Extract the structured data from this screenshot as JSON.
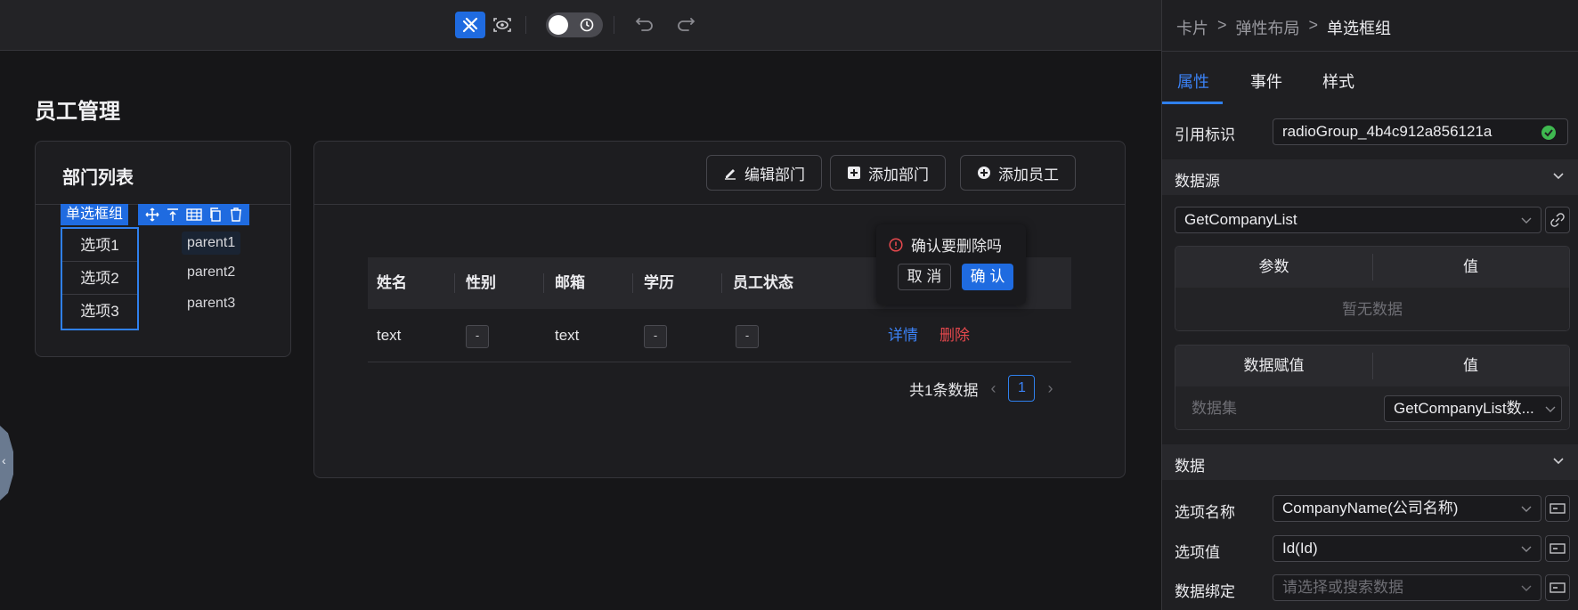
{
  "toolbar": {
    "toggle_state": "dark"
  },
  "page": {
    "title": "员工管理"
  },
  "dept_card": {
    "title": "部门列表",
    "selected_component_label": "单选框组",
    "radio_options": [
      "选项1",
      "选项2",
      "选项3"
    ],
    "tree_items": [
      "parent1",
      "parent2",
      "parent3"
    ]
  },
  "main": {
    "buttons": {
      "edit_dept": "编辑部门",
      "add_dept": "添加部门",
      "add_employee": "添加员工"
    },
    "columns": [
      "姓名",
      "性别",
      "邮箱",
      "学历",
      "员工状态"
    ],
    "row": {
      "name": "text",
      "gender": "-",
      "email": "text",
      "education": "-",
      "status": "-",
      "detail": "详情",
      "delete": "删除"
    },
    "pagination": {
      "total_text": "共1条数据",
      "current_page": "1"
    },
    "popconfirm": {
      "message": "确认要删除吗",
      "cancel": "取 消",
      "confirm": "确 认"
    }
  },
  "panel": {
    "breadcrumb": [
      "卡片",
      "弹性布局",
      "单选框组"
    ],
    "breadcrumb_sep": ">",
    "tabs": [
      "属性",
      "事件",
      "样式"
    ],
    "ref_label": "引用标识",
    "ref_value": "radioGroup_4b4c912a856121a",
    "datasource_section": "数据源",
    "datasource_value": "GetCompanyList",
    "params_table": {
      "col1": "参数",
      "col2": "值",
      "empty": "暂无数据"
    },
    "assign_table": {
      "col1": "数据赋值",
      "col2": "值",
      "row_label": "数据集",
      "row_value": "GetCompanyList数..."
    },
    "data_section": "数据",
    "option_name_label": "选项名称",
    "option_name_value": "CompanyName(公司名称)",
    "option_value_label": "选项值",
    "option_value_value": "Id(Id)",
    "binding_label": "数据绑定",
    "binding_placeholder": "请选择或搜索数据"
  },
  "colors": {
    "accent": "#1f6be0",
    "link": "#3b82f6",
    "danger": "#e5484d",
    "success": "#3fb950"
  }
}
